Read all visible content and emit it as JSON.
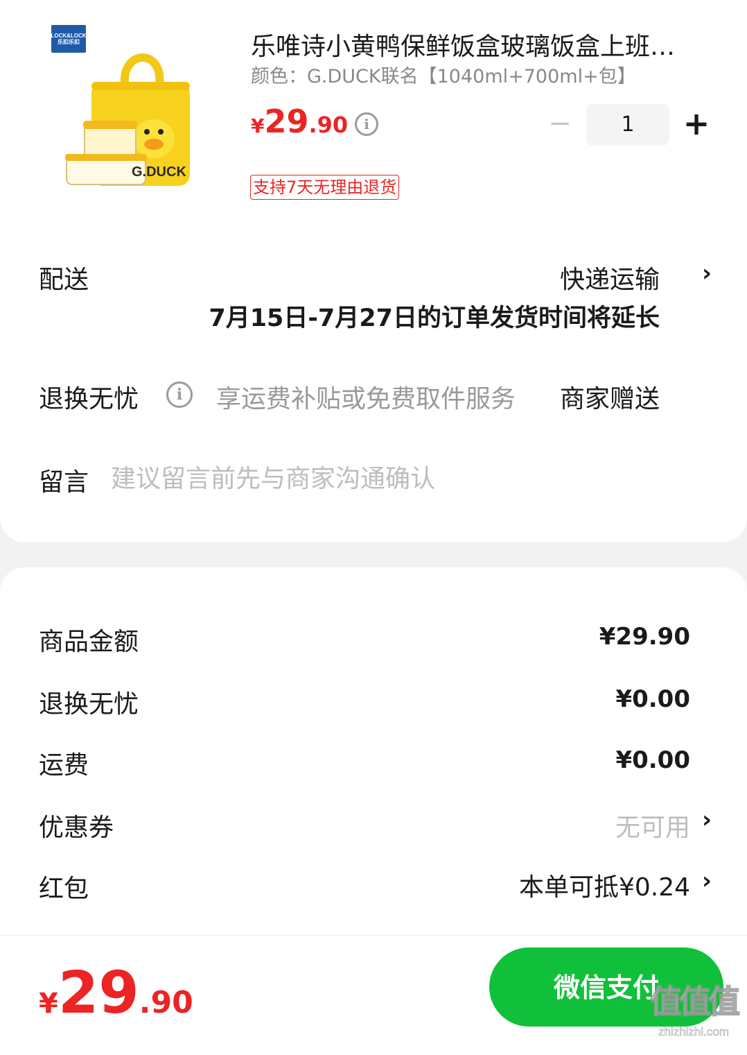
{
  "product": {
    "brand_logo_text": "LOCK&LOCK 乐扣乐扣",
    "title": "乐唯诗小黄鸭保鲜饭盒玻璃饭盒上班…",
    "spec": "颜色：G.DUCK联名【1040ml+700ml+包】",
    "price_currency": "¥",
    "price_integer": "29",
    "price_decimal": ".90",
    "quantity": "1",
    "quantity_minus": "−",
    "quantity_plus": "+",
    "return_tag": "支持7天无理由退货",
    "image_text": "G.DUCK"
  },
  "delivery": {
    "label": "配送",
    "method": "快递运输",
    "note": "7月15日-7月27日的订单发货时间将延长"
  },
  "returns": {
    "label": "退换无忧",
    "description": "享运费补贴或免费取件服务",
    "gift": "商家赠送"
  },
  "message": {
    "label": "留言",
    "placeholder": "建议留言前先与商家沟通确认"
  },
  "summary": {
    "rows": [
      {
        "label": "商品金额",
        "value": "¥29.90"
      },
      {
        "label": "退换无忧",
        "value": "¥0.00"
      },
      {
        "label": "运费",
        "value": "¥0.00"
      },
      {
        "label": "优惠券",
        "value": "无可用"
      },
      {
        "label": "红包",
        "value": "本单可抵¥0.24"
      }
    ]
  },
  "footer": {
    "total_currency": "¥",
    "total_integer": "29",
    "total_decimal": ".90",
    "pay_label": "微信支付"
  },
  "watermark": {
    "big": "值值值",
    "small": "zhizhizhi.com"
  },
  "colors": {
    "price_red": "#ec2424",
    "wechat_green": "#10c03a",
    "duck_yellow": "#f7d21e"
  },
  "icons": {
    "info": "info-circle-icon",
    "chevron": "chevron-right-icon"
  }
}
